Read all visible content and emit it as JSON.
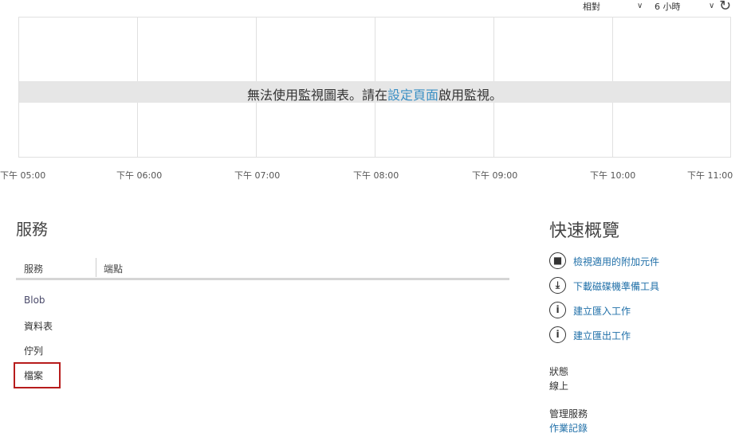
{
  "toolbar": {
    "mode_value": "相對",
    "range_value": "6 小時"
  },
  "chart": {
    "message_before": "無法使用監視圖表。請在",
    "message_link": "設定頁面",
    "message_after": "啟用監視。",
    "time_ticks": [
      "下午 05:00",
      "下午 06:00",
      "下午 07:00",
      "下午 08:00",
      "下午 09:00",
      "下午 10:00",
      "下午 11:00"
    ]
  },
  "services": {
    "title": "服務",
    "columns": [
      "服務",
      "端點"
    ],
    "items": [
      "Blob",
      "資料表",
      "佇列",
      "檔案"
    ]
  },
  "quick_glance": {
    "title": "快速概覽",
    "links": [
      {
        "icon": "bag-icon",
        "label": "檢視適用的附加元件"
      },
      {
        "icon": "download-icon",
        "label": "下載磁碟機準備工具"
      },
      {
        "icon": "info-icon",
        "label": "建立匯入工作"
      },
      {
        "icon": "info-icon",
        "label": "建立匯出工作"
      }
    ],
    "status_label": "狀態",
    "status_value": "線上",
    "mgmt_label": "管理服務",
    "mgmt_link": "作業記錄"
  }
}
